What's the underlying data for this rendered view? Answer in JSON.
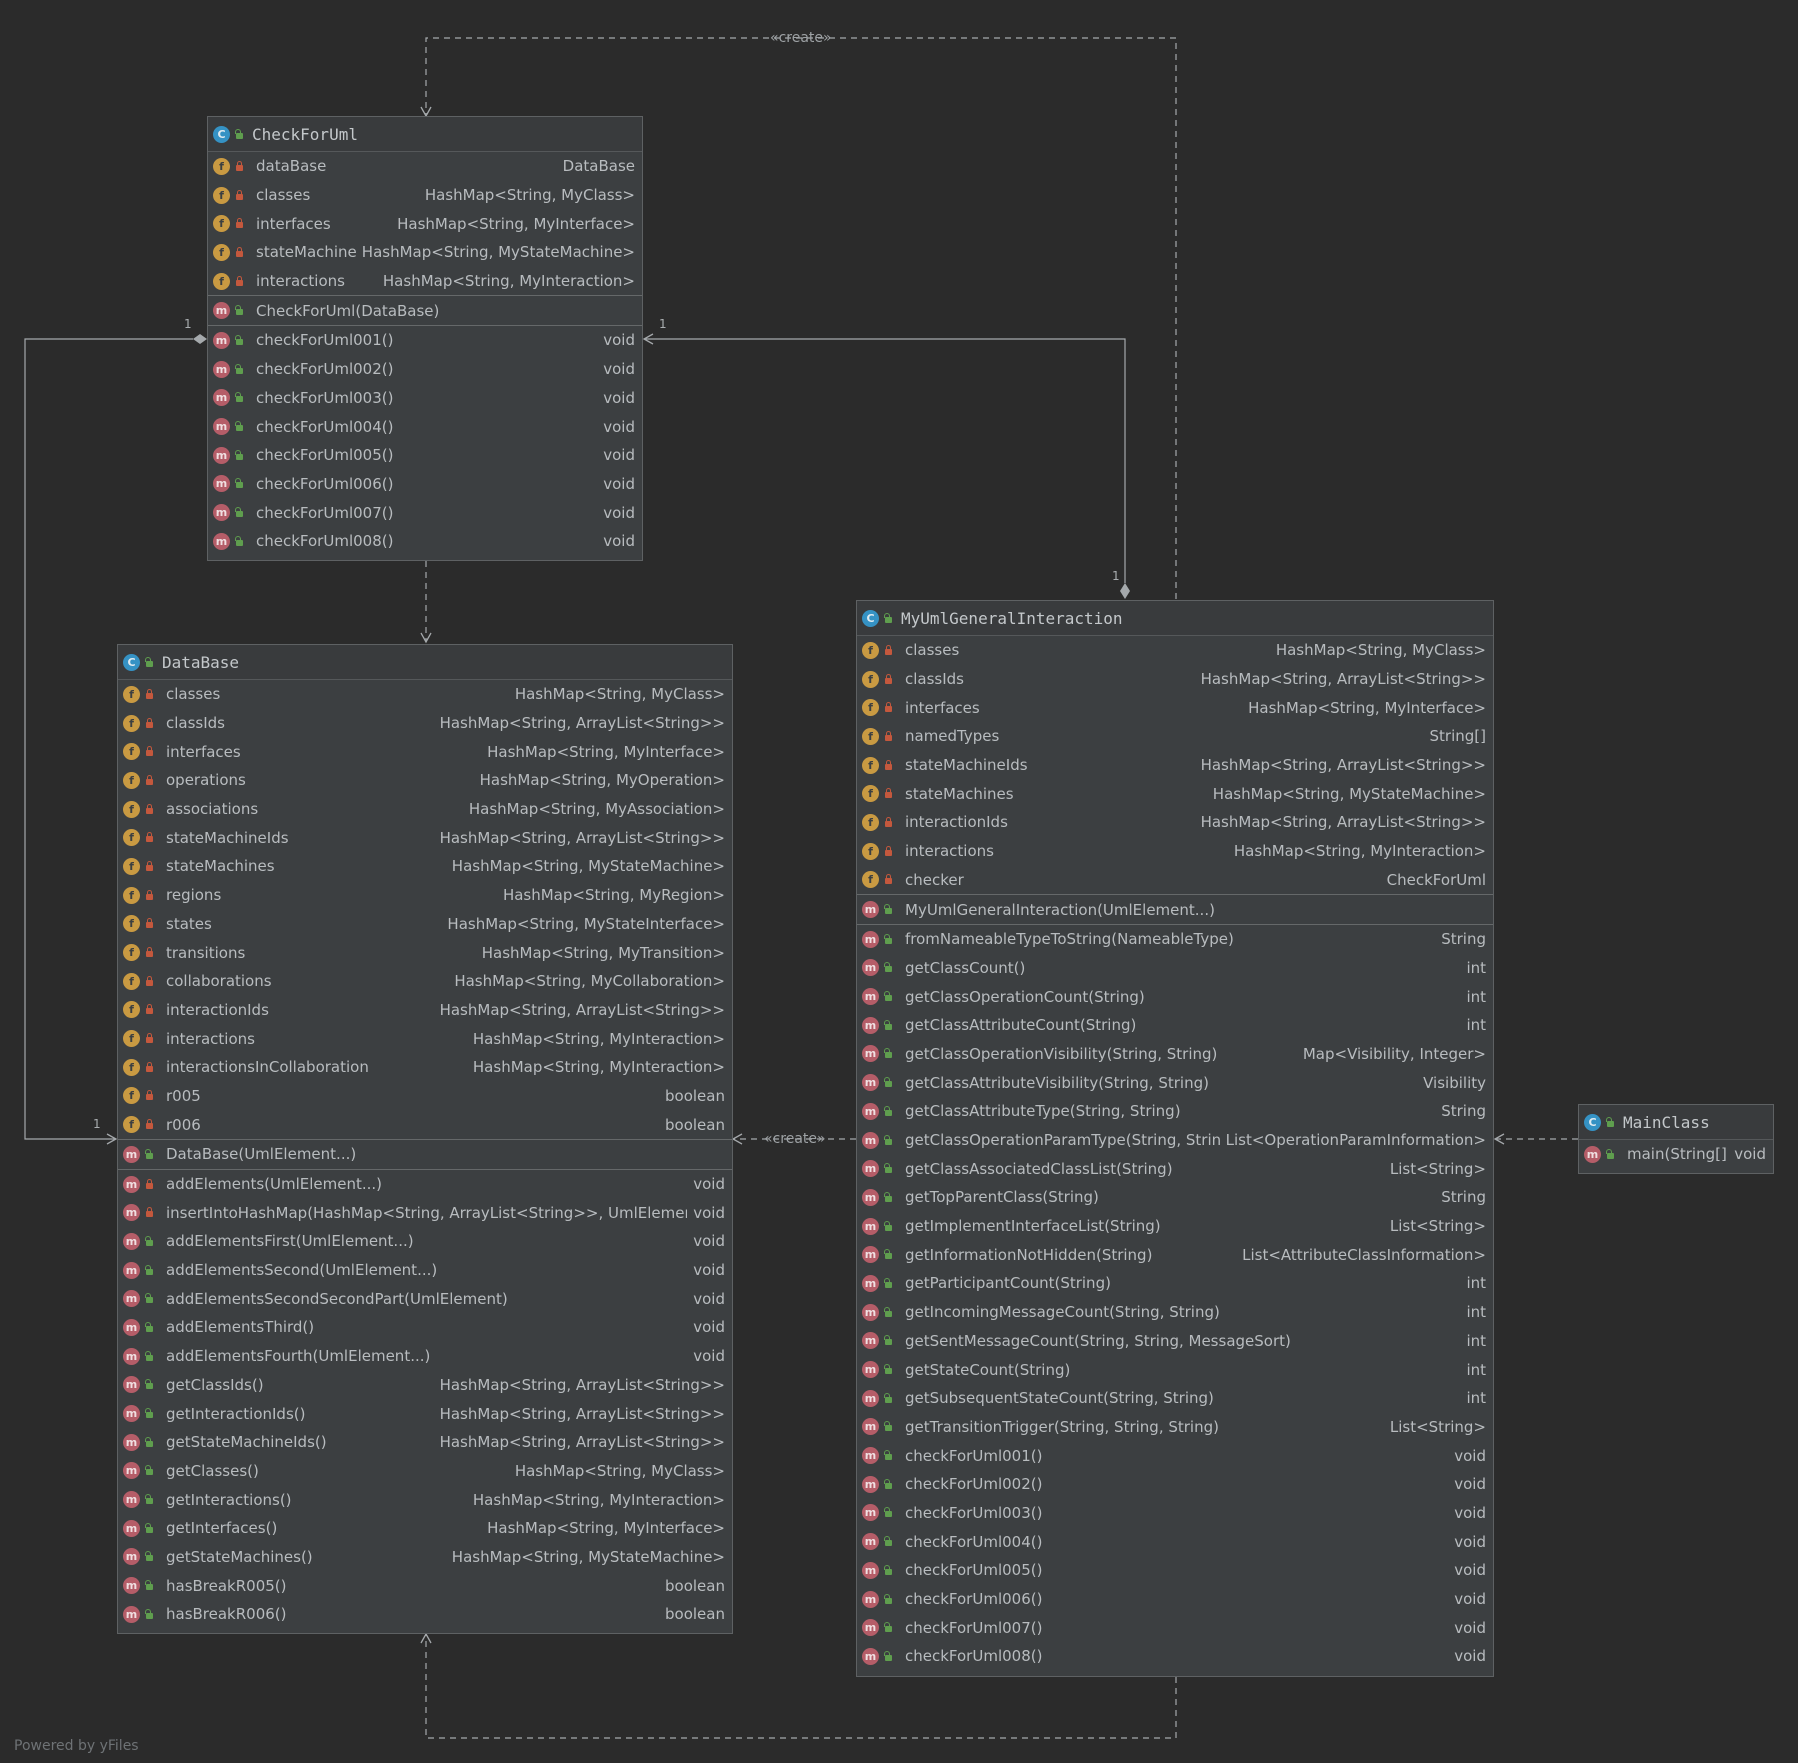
{
  "nodes": {
    "checkforuml": {
      "title": "CheckForUml",
      "fields": [
        {
          "name": "dataBase",
          "type": "DataBase"
        },
        {
          "name": "classes",
          "type": "HashMap<String, MyClass>"
        },
        {
          "name": "interfaces",
          "type": "HashMap<String, MyInterface>"
        },
        {
          "name": "stateMachines",
          "type": "HashMap<String, MyStateMachine>"
        },
        {
          "name": "interactions",
          "type": "HashMap<String, MyInteraction>"
        }
      ],
      "constructors": [
        {
          "name": "CheckForUml(DataBase)",
          "type": ""
        }
      ],
      "methods": [
        {
          "name": "checkForUml001()",
          "type": "void"
        },
        {
          "name": "checkForUml002()",
          "type": "void"
        },
        {
          "name": "checkForUml003()",
          "type": "void"
        },
        {
          "name": "checkForUml004()",
          "type": "void"
        },
        {
          "name": "checkForUml005()",
          "type": "void"
        },
        {
          "name": "checkForUml006()",
          "type": "void"
        },
        {
          "name": "checkForUml007()",
          "type": "void"
        },
        {
          "name": "checkForUml008()",
          "type": "void"
        }
      ]
    },
    "database": {
      "title": "DataBase",
      "fields": [
        {
          "name": "classes",
          "type": "HashMap<String, MyClass>"
        },
        {
          "name": "classIds",
          "type": "HashMap<String, ArrayList<String>>"
        },
        {
          "name": "interfaces",
          "type": "HashMap<String, MyInterface>"
        },
        {
          "name": "operations",
          "type": "HashMap<String, MyOperation>"
        },
        {
          "name": "associations",
          "type": "HashMap<String, MyAssociation>"
        },
        {
          "name": "stateMachineIds",
          "type": "HashMap<String, ArrayList<String>>"
        },
        {
          "name": "stateMachines",
          "type": "HashMap<String, MyStateMachine>"
        },
        {
          "name": "regions",
          "type": "HashMap<String, MyRegion>"
        },
        {
          "name": "states",
          "type": "HashMap<String, MyStateInterface>"
        },
        {
          "name": "transitions",
          "type": "HashMap<String, MyTransition>"
        },
        {
          "name": "collaborations",
          "type": "HashMap<String, MyCollaboration>"
        },
        {
          "name": "interactionIds",
          "type": "HashMap<String, ArrayList<String>>"
        },
        {
          "name": "interactions",
          "type": "HashMap<String, MyInteraction>"
        },
        {
          "name": "interactionsInCollaboration",
          "type": "HashMap<String, MyInteraction>"
        },
        {
          "name": "r005",
          "type": "boolean"
        },
        {
          "name": "r006",
          "type": "boolean"
        }
      ],
      "constructors": [
        {
          "name": "DataBase(UmlElement...)",
          "type": ""
        }
      ],
      "methods": [
        {
          "name": "addElements(UmlElement...)",
          "type": "void"
        },
        {
          "name": "insertIntoHashMap(HashMap<String, ArrayList<String>>, UmlElement)",
          "type": "void"
        },
        {
          "name": "addElementsFirst(UmlElement...)",
          "type": "void"
        },
        {
          "name": "addElementsSecond(UmlElement...)",
          "type": "void"
        },
        {
          "name": "addElementsSecondSecondPart(UmlElement)",
          "type": "void"
        },
        {
          "name": "addElementsThird()",
          "type": "void"
        },
        {
          "name": "addElementsFourth(UmlElement...)",
          "type": "void"
        },
        {
          "name": "getClassIds()",
          "type": "HashMap<String, ArrayList<String>>"
        },
        {
          "name": "getInteractionIds()",
          "type": "HashMap<String, ArrayList<String>>"
        },
        {
          "name": "getStateMachineIds()",
          "type": "HashMap<String, ArrayList<String>>"
        },
        {
          "name": "getClasses()",
          "type": "HashMap<String, MyClass>"
        },
        {
          "name": "getInteractions()",
          "type": "HashMap<String, MyInteraction>"
        },
        {
          "name": "getInterfaces()",
          "type": "HashMap<String, MyInterface>"
        },
        {
          "name": "getStateMachines()",
          "type": "HashMap<String, MyStateMachine>"
        },
        {
          "name": "hasBreakR005()",
          "type": "boolean"
        },
        {
          "name": "hasBreakR006()",
          "type": "boolean"
        }
      ]
    },
    "mugi": {
      "title": "MyUmlGeneralInteraction",
      "fields": [
        {
          "name": "classes",
          "type": "HashMap<String, MyClass>"
        },
        {
          "name": "classIds",
          "type": "HashMap<String, ArrayList<String>>"
        },
        {
          "name": "interfaces",
          "type": "HashMap<String, MyInterface>"
        },
        {
          "name": "namedTypes",
          "type": "String[]"
        },
        {
          "name": "stateMachineIds",
          "type": "HashMap<String, ArrayList<String>>"
        },
        {
          "name": "stateMachines",
          "type": "HashMap<String, MyStateMachine>"
        },
        {
          "name": "interactionIds",
          "type": "HashMap<String, ArrayList<String>>"
        },
        {
          "name": "interactions",
          "type": "HashMap<String, MyInteraction>"
        },
        {
          "name": "checker",
          "type": "CheckForUml"
        }
      ],
      "constructors": [
        {
          "name": "MyUmlGeneralInteraction(UmlElement...)",
          "type": ""
        }
      ],
      "methods": [
        {
          "name": "fromNameableTypeToString(NameableType)",
          "type": "String"
        },
        {
          "name": "getClassCount()",
          "type": "int"
        },
        {
          "name": "getClassOperationCount(String)",
          "type": "int"
        },
        {
          "name": "getClassAttributeCount(String)",
          "type": "int"
        },
        {
          "name": "getClassOperationVisibility(String, String)",
          "type": "Map<Visibility, Integer>"
        },
        {
          "name": "getClassAttributeVisibility(String, String)",
          "type": "Visibility"
        },
        {
          "name": "getClassAttributeType(String, String)",
          "type": "String"
        },
        {
          "name": "getClassOperationParamType(String, String)",
          "type": "List<OperationParamInformation>"
        },
        {
          "name": "getClassAssociatedClassList(String)",
          "type": "List<String>"
        },
        {
          "name": "getTopParentClass(String)",
          "type": "String"
        },
        {
          "name": "getImplementInterfaceList(String)",
          "type": "List<String>"
        },
        {
          "name": "getInformationNotHidden(String)",
          "type": "List<AttributeClassInformation>"
        },
        {
          "name": "getParticipantCount(String)",
          "type": "int"
        },
        {
          "name": "getIncomingMessageCount(String, String)",
          "type": "int"
        },
        {
          "name": "getSentMessageCount(String, String, MessageSort)",
          "type": "int"
        },
        {
          "name": "getStateCount(String)",
          "type": "int"
        },
        {
          "name": "getSubsequentStateCount(String, String)",
          "type": "int"
        },
        {
          "name": "getTransitionTrigger(String, String, String)",
          "type": "List<String>"
        },
        {
          "name": "checkForUml001()",
          "type": "void"
        },
        {
          "name": "checkForUml002()",
          "type": "void"
        },
        {
          "name": "checkForUml003()",
          "type": "void"
        },
        {
          "name": "checkForUml004()",
          "type": "void"
        },
        {
          "name": "checkForUml005()",
          "type": "void"
        },
        {
          "name": "checkForUml006()",
          "type": "void"
        },
        {
          "name": "checkForUml007()",
          "type": "void"
        },
        {
          "name": "checkForUml008()",
          "type": "void"
        }
      ]
    },
    "mainclass": {
      "title": "MainClass",
      "fields": [],
      "constructors": [],
      "methods": [
        {
          "name": "main(String[])",
          "type": "void"
        }
      ]
    }
  },
  "edge_labels": {
    "create_top": "«create»",
    "create_mid": "«create»"
  },
  "multiplicities": {
    "one": "1"
  },
  "footer": "Powered by yFiles",
  "colors": {
    "background": "#2b2b2b",
    "node_fill": "#3c3f41",
    "class_badge": "#3592c4",
    "field_badge": "#c99a42",
    "method_badge": "#b55d68",
    "public_icon": "#5f9e4e",
    "private_icon": "#c4583d",
    "edge": "#a5a9ac"
  }
}
